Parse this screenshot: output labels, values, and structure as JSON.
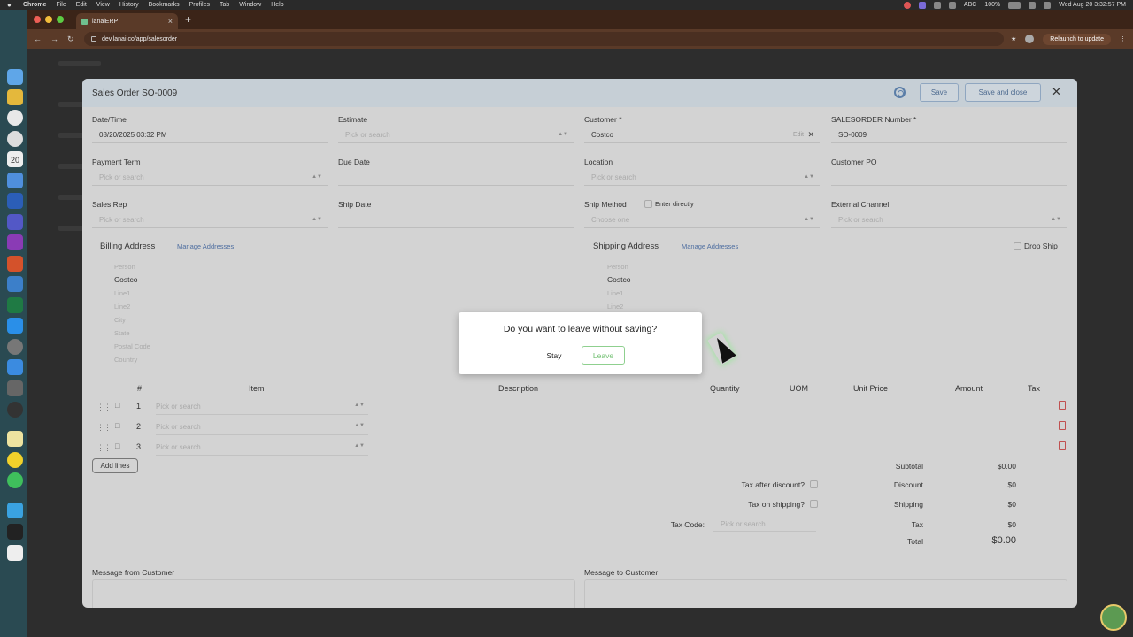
{
  "menubar": {
    "app": "Chrome",
    "items": [
      "File",
      "Edit",
      "View",
      "History",
      "Bookmarks",
      "Profiles",
      "Tab",
      "Window",
      "Help"
    ],
    "battery": "100%",
    "input": "ABC",
    "clock": "Wed Aug 20  3:32:57 PM"
  },
  "browser": {
    "tab_title": "lanaiERP",
    "url": "dev.lanai.co/app/salesorder",
    "relaunch_label": "Relaunch to update"
  },
  "dock": {
    "calendar_day": "20"
  },
  "modal": {
    "title": "Sales Order SO-0009",
    "save_label": "Save",
    "save_close_label": "Save and close",
    "fields": {
      "datetime_label": "Date/Time",
      "datetime_value": "08/20/2025 03:32 PM",
      "estimate_label": "Estimate",
      "estimate_placeholder": "Pick or search",
      "customer_label": "Customer *",
      "customer_value": "Costco",
      "customer_edit": "Edit",
      "so_number_label": "SALESORDER Number *",
      "so_number_value": "SO-0009",
      "payment_term_label": "Payment Term",
      "payment_term_placeholder": "Pick or search",
      "due_date_label": "Due Date",
      "location_label": "Location",
      "location_placeholder": "Pick or search",
      "customer_po_label": "Customer PO",
      "sales_rep_label": "Sales Rep",
      "sales_rep_placeholder": "Pick or search",
      "ship_date_label": "Ship Date",
      "ship_method_label": "Ship Method",
      "ship_method_enter": "Enter directly",
      "ship_method_placeholder": "Choose one",
      "external_channel_label": "External Channel",
      "external_channel_placeholder": "Pick or search"
    },
    "billing": {
      "title": "Billing Address",
      "manage": "Manage Addresses",
      "person": "Person",
      "company": "Costco",
      "line1": "Line1",
      "line2": "Line2",
      "city": "City",
      "state": "State",
      "postal": "Postal Code",
      "country": "Country"
    },
    "shipping": {
      "title": "Shipping Address",
      "manage": "Manage Addresses",
      "drop_ship": "Drop Ship",
      "person": "Person",
      "company": "Costco",
      "line1": "Line1",
      "line2": "Line2"
    },
    "lines": {
      "headers": {
        "num": "#",
        "item": "Item",
        "description": "Description",
        "quantity": "Quantity",
        "uom": "UOM",
        "unit_price": "Unit Price",
        "amount": "Amount",
        "tax": "Tax"
      },
      "rows": [
        {
          "num": "1",
          "item_placeholder": "Pick or search"
        },
        {
          "num": "2",
          "item_placeholder": "Pick or search"
        },
        {
          "num": "3",
          "item_placeholder": "Pick or search"
        }
      ],
      "add_lines": "Add lines"
    },
    "totals": {
      "subtotal_label": "Subtotal",
      "subtotal_value": "$0.00",
      "tax_after_discount": "Tax after discount?",
      "discount_label": "Discount",
      "discount_value": "$0",
      "tax_on_shipping": "Tax on shipping?",
      "shipping_label": "Shipping",
      "shipping_value": "$0",
      "tax_code_label": "Tax Code:",
      "tax_code_placeholder": "Pick or search",
      "tax_label": "Tax",
      "tax_value": "$0",
      "total_label": "Total",
      "total_value": "$0.00"
    },
    "message_from_customer": "Message from Customer",
    "message_to_customer": "Message to Customer"
  },
  "dialog": {
    "question": "Do you want to leave without saving?",
    "stay": "Stay",
    "leave": "Leave"
  }
}
